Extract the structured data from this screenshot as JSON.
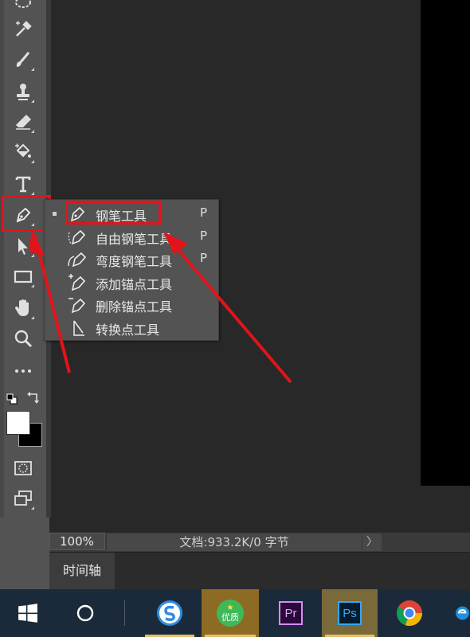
{
  "flyout": {
    "items": [
      {
        "label": "钢笔工具",
        "shortcut": "P",
        "icon": "pen-tool-icon"
      },
      {
        "label": "自由钢笔工具",
        "shortcut": "P",
        "icon": "freeform-pen-icon"
      },
      {
        "label": "弯度钢笔工具",
        "shortcut": "P",
        "icon": "curvature-pen-icon"
      },
      {
        "label": "添加锚点工具",
        "shortcut": "",
        "icon": "add-anchor-icon"
      },
      {
        "label": "删除锚点工具",
        "shortcut": "",
        "icon": "delete-anchor-icon"
      },
      {
        "label": "转换点工具",
        "shortcut": "",
        "icon": "convert-point-icon"
      }
    ]
  },
  "status": {
    "zoom": "100%",
    "doc_info": "文档:933.2K/0 字节",
    "arrow": "〉"
  },
  "timeline": {
    "tab": "时间轴"
  },
  "taskbar": {
    "badge_text": "优质",
    "premiere": "Pr",
    "photoshop": "Ps"
  },
  "colors": {
    "highlight": "#e1141b",
    "panel": "#535353",
    "canvas": "#282828",
    "taskbar": "#1b2a3a"
  },
  "toolbar_icons": [
    "lasso-icon",
    "eyedropper-icon",
    "brush-icon",
    "stamp-icon",
    "eraser-icon",
    "paint-bucket-icon",
    "type-icon",
    "pen-icon",
    "selection-arrow-icon",
    "rectangle-icon",
    "hand-icon",
    "zoom-icon",
    "more-icon",
    "swap-colors-icon",
    "foreground-color-swatch",
    "quick-mask-icon",
    "screen-mode-icon"
  ]
}
